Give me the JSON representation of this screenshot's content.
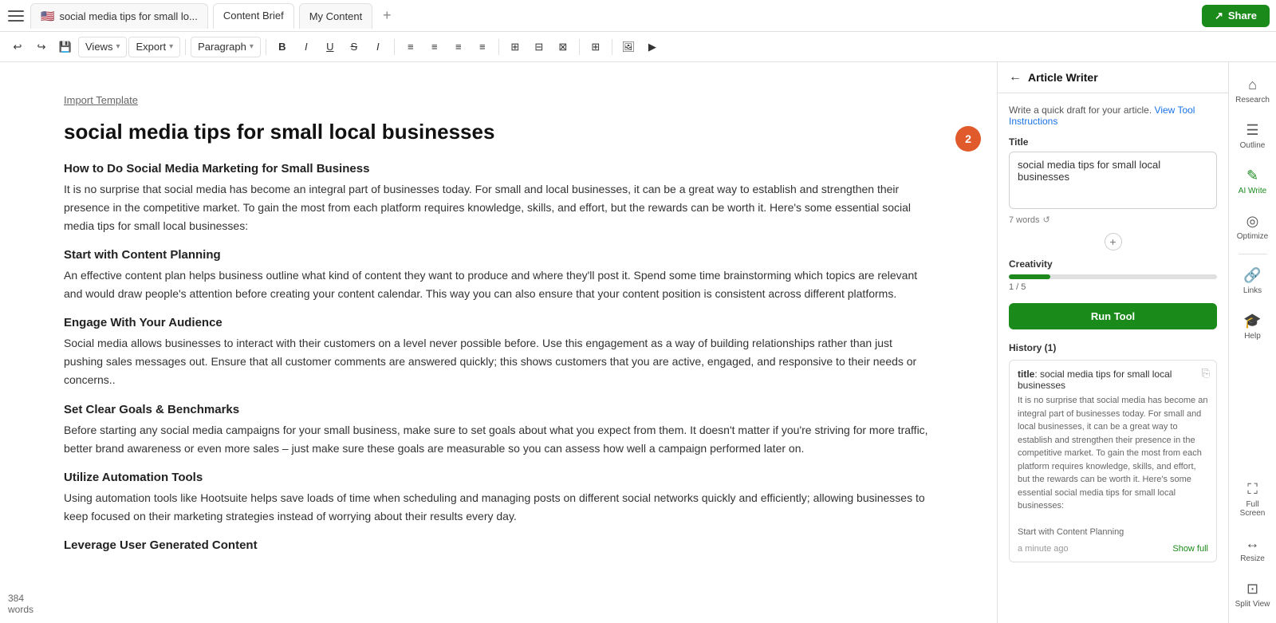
{
  "topbar": {
    "tab1_label": "social media tips for small lo...",
    "tab1_flag": "🇺🇸",
    "tab2_label": "Content Brief",
    "tab3_label": "My Content",
    "share_label": "Share"
  },
  "toolbar": {
    "views_label": "Views",
    "export_label": "Export",
    "paragraph_label": "Paragraph"
  },
  "editor": {
    "import_template": "Import Template",
    "doc_title": "social media tips for small local businesses",
    "bubble_count": "2",
    "sections": [
      {
        "heading": "How to Do Social Media Marketing for Small Business",
        "body": "It is no surprise that social media has become an integral part of businesses today. For small and local businesses, it can be a great way to establish and strengthen their presence in the competitive market. To gain the most from each platform requires knowledge, skills, and effort, but the rewards can be worth it. Here's some essential social media tips for small local businesses:"
      },
      {
        "heading": "Start with Content Planning",
        "body": "An effective content plan helps business outline what kind of content they want to produce and where they'll post it. Spend some time brainstorming which topics are relevant and would draw people's attention before creating your content calendar. This way you can also ensure that your content position is consistent across different platforms."
      },
      {
        "heading": "Engage With Your Audience",
        "body": "Social media allows businesses to interact with their customers on a level never possible before. Use this engagement as a way of building relationships rather than just pushing sales messages out. Ensure that all customer comments are answered quickly; this shows customers that you are active, engaged, and responsive to their needs or concerns.."
      },
      {
        "heading": "Set Clear Goals & Benchmarks",
        "body": "Before starting any social media campaigns for your small business, make sure to set goals about what you expect from them. It doesn't matter if you're striving for more traffic, better brand awareness or even more sales – just make sure these goals are measurable so you can assess how well a campaign performed later on."
      },
      {
        "heading": "Utilize Automation Tools",
        "body": "Using automation tools like Hootsuite helps save loads of time when scheduling and managing posts on different social networks quickly and efficiently; allowing businesses to keep focused on their marketing strategies instead of worrying about their results every day."
      },
      {
        "heading": "Leverage User Generated Content",
        "body": ""
      }
    ],
    "word_count": "384",
    "word_label": "words"
  },
  "right_panel": {
    "title": "Article Writer",
    "desc": "Write a quick draft for your article.",
    "view_instructions_label": "View Tool Instructions",
    "field_title_label": "Title",
    "title_value": "social media tips for small local businesses",
    "word_count": "7 words",
    "creativity_label": "Creativity",
    "creativity_value": "1 / 5",
    "run_tool_label": "Run Tool",
    "history_label": "History (1)",
    "history_item": {
      "title_prefix": "title",
      "title_value": "social media tips for small local businesses",
      "preview": "It is no surprise that social media has become an integral part of businesses today. For small and local businesses, it can be a great way to establish and strengthen their presence in the competitive market. To gain the most from each platform requires knowledge, skills, and effort, but the rewards can be worth it. Here's some essential social media tips for small local businesses:",
      "sub_heading": "Start with Content Planning",
      "time": "a minute ago",
      "show_full": "Show full"
    }
  },
  "far_sidebar": {
    "items": [
      {
        "id": "research",
        "icon": "⌂",
        "label": "Research",
        "active": false
      },
      {
        "id": "outline",
        "icon": "☰",
        "label": "Outline",
        "active": false
      },
      {
        "id": "ai-write",
        "icon": "✎",
        "label": "AI Write",
        "active": true
      },
      {
        "id": "optimize",
        "icon": "◎",
        "label": "Optimize",
        "active": false
      },
      {
        "id": "links",
        "icon": "🔗",
        "label": "Links",
        "active": false
      },
      {
        "id": "help",
        "icon": "🎓",
        "label": "Help",
        "active": false
      },
      {
        "id": "fullscreen",
        "icon": "⛶",
        "label": "Full Screen",
        "active": false
      },
      {
        "id": "resize",
        "icon": "↔",
        "label": "Resize",
        "active": false
      },
      {
        "id": "splitview",
        "icon": "⊡",
        "label": "Split View",
        "active": false
      }
    ]
  }
}
